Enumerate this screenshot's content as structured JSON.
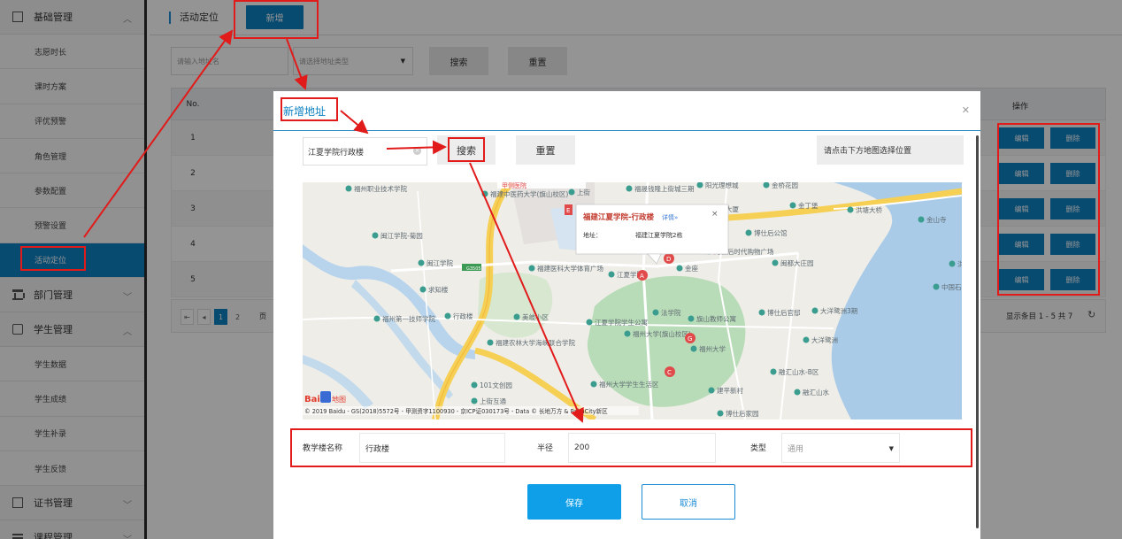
{
  "sidebar": {
    "groups": [
      {
        "label": "基础管理",
        "icon": "box-icon",
        "expanded": true,
        "items": [
          "志愿时长",
          "课时方案",
          "评优预警",
          "角色管理",
          "参数配置",
          "预警设置",
          "活动定位"
        ]
      },
      {
        "label": "部门管理",
        "icon": "bank-icon",
        "expanded": false
      },
      {
        "label": "学生管理",
        "icon": "person-icon",
        "expanded": true,
        "items": [
          "学生数据",
          "学生成绩",
          "学生补录",
          "学生反馈"
        ]
      },
      {
        "label": "证书管理",
        "icon": "certificate-icon",
        "expanded": false
      },
      {
        "label": "课程管理",
        "icon": "list-icon",
        "expanded": false
      }
    ],
    "active_item": "活动定位"
  },
  "header": {
    "page_title": "活动定位",
    "add_label": "新增"
  },
  "filters": {
    "name_placeholder": "请输入地址名",
    "type_placeholder": "请选择地址类型",
    "search_label": "搜索",
    "reset_label": "重置"
  },
  "table": {
    "col_no": "No.",
    "col_op": "操作",
    "rows": [
      "1",
      "2",
      "3",
      "4",
      "5"
    ],
    "edit_label": "编辑",
    "delete_label": "删除"
  },
  "pager": {
    "pages": [
      "1",
      "2"
    ],
    "current": "1",
    "partial_label": "页",
    "info": "显示条目 1 - 5 共 7"
  },
  "modal": {
    "title": "新增地址",
    "search_value": "江夏学院行政楼",
    "search_label": "搜索",
    "reset_label": "重置",
    "hint": "请点击下方地图选择位置",
    "map": {
      "popup_title": "福建江夏学院-行政楼",
      "popup_detail": "详情»",
      "popup_addr_label": "地址：",
      "popup_addr_value": "福建江夏学院2栋",
      "attribution": "© 2019 Baidu - GS(2018)5572号 - 甲测资字1100930 - 京ICP证030173号 - Data © 长地万方 & PalmCity新区",
      "logo_text": "Bai",
      "logo_text2": "地图",
      "labels": [
        "福州职业技术学院",
        "闽江学院-菊园",
        "闽江学院",
        "求知楼",
        "行政楼",
        "福州第一技师学院",
        "福建中医药大学(旗山校区)",
        "福建医科大学体育广场",
        "美岐小区",
        "福建农林大学海峡联合学院",
        "101文创园",
        "上街",
        "福晟钱隆上街城三期",
        "阳光理想城",
        "金桥花园",
        "大厦",
        "金丁堡",
        "洪塘大桥",
        "金山寺",
        "博仕后公馆",
        "海仕后时代购物广场",
        "闽都大庄园",
        "江夏学院",
        "江夏学院学生公寓",
        "金座",
        "法学院",
        "旗山教师公寓",
        "博仕后官邸",
        "大洋鹭洲3期",
        "大洋鹭洲",
        "福州大学(旗山校区)",
        "福州大学",
        "融汇山水-B区",
        "融汇山水",
        "建平新村",
        "福州大学学生生活区",
        "上街互通",
        "博仕后家园",
        "中国石",
        "洪",
        "甲侧医院",
        "G3505"
      ]
    },
    "form": {
      "name_label": "教学楼名称",
      "name_value": "行政楼",
      "radius_label": "半径",
      "radius_value": "200",
      "type_label": "类型",
      "type_value": "通用"
    },
    "save_label": "保存",
    "cancel_label": "取消"
  },
  "colors": {
    "accent": "#0e81c2",
    "annotation": "#e11a1a",
    "sidebar_border": "#2a2a2a"
  }
}
